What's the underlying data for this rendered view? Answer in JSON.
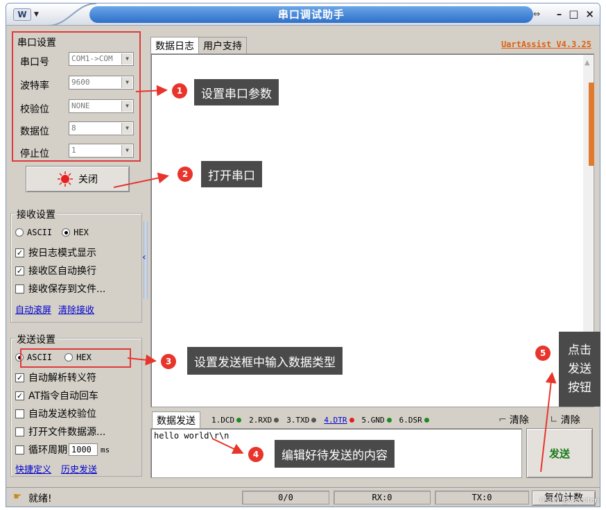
{
  "window": {
    "title": "串口调试助手",
    "logo_glyph": "W",
    "btn_min": "–",
    "btn_max": "□",
    "btn_close": "×",
    "pin_glyph": "⇔"
  },
  "serial_settings": {
    "title": "串口设置",
    "fields": [
      {
        "label": "串口号",
        "value": "COM1->COM"
      },
      {
        "label": "波特率",
        "value": "9600"
      },
      {
        "label": "校验位",
        "value": "NONE"
      },
      {
        "label": "数据位",
        "value": "8"
      },
      {
        "label": "停止位",
        "value": "1"
      }
    ],
    "close_button": "关闭"
  },
  "receive_settings": {
    "title": "接收设置",
    "mode_ascii": "ASCII",
    "mode_hex": "HEX",
    "mode_selected": "HEX",
    "options": [
      {
        "label": "按日志模式显示",
        "checked": true
      },
      {
        "label": "接收区自动换行",
        "checked": true
      },
      {
        "label": "接收保存到文件...",
        "checked": false
      }
    ],
    "links": [
      "自动滚屏",
      "清除接收"
    ]
  },
  "send_settings": {
    "title": "发送设置",
    "mode_ascii": "ASCII",
    "mode_hex": "HEX",
    "mode_selected": "ASCII",
    "options": [
      {
        "label": "自动解析转义符",
        "checked": true
      },
      {
        "label": "AT指令自动回车",
        "checked": true
      },
      {
        "label": "自动发送校验位",
        "checked": false
      },
      {
        "label": "打开文件数据源...",
        "checked": false
      }
    ],
    "cycle_label": "循环周期",
    "cycle_value": "1000",
    "cycle_unit": "ms",
    "links": [
      "快捷定义",
      "历史发送"
    ]
  },
  "tabs": [
    "数据日志",
    "用户支持"
  ],
  "version": "UartAssist V4.3.25",
  "send_area": {
    "tab": "数据发送",
    "signals": [
      {
        "label": "1.DCD",
        "color": "#1f8a1f"
      },
      {
        "label": "2.RXD",
        "color": "#555555"
      },
      {
        "label": "3.TXD",
        "color": "#555555"
      },
      {
        "label": "4.DTR",
        "color": "#e02020",
        "link": true
      },
      {
        "label": "5.GND",
        "color": "#1f8a1f"
      },
      {
        "label": "6.DSR",
        "color": "#1f8a1f"
      }
    ],
    "clear_1": "清除",
    "clear_2": "清除",
    "input_value": "hello world\\r\\n",
    "send_button": "发送"
  },
  "status": {
    "text": "就绪!",
    "count": "0/0",
    "rx": "RX:0",
    "tx": "TX:0",
    "reset": "复位计数",
    "watermark": "CSDN @weepteri"
  },
  "annotations": [
    {
      "num": "1",
      "text": "设置串口参数"
    },
    {
      "num": "2",
      "text": "打开串口"
    },
    {
      "num": "3",
      "text": "设置发送框中输入数据类型"
    },
    {
      "num": "4",
      "text": "编辑好待发送的内容"
    },
    {
      "num": "5",
      "text_lines": [
        "点击",
        "发送",
        "按钮"
      ]
    }
  ]
}
